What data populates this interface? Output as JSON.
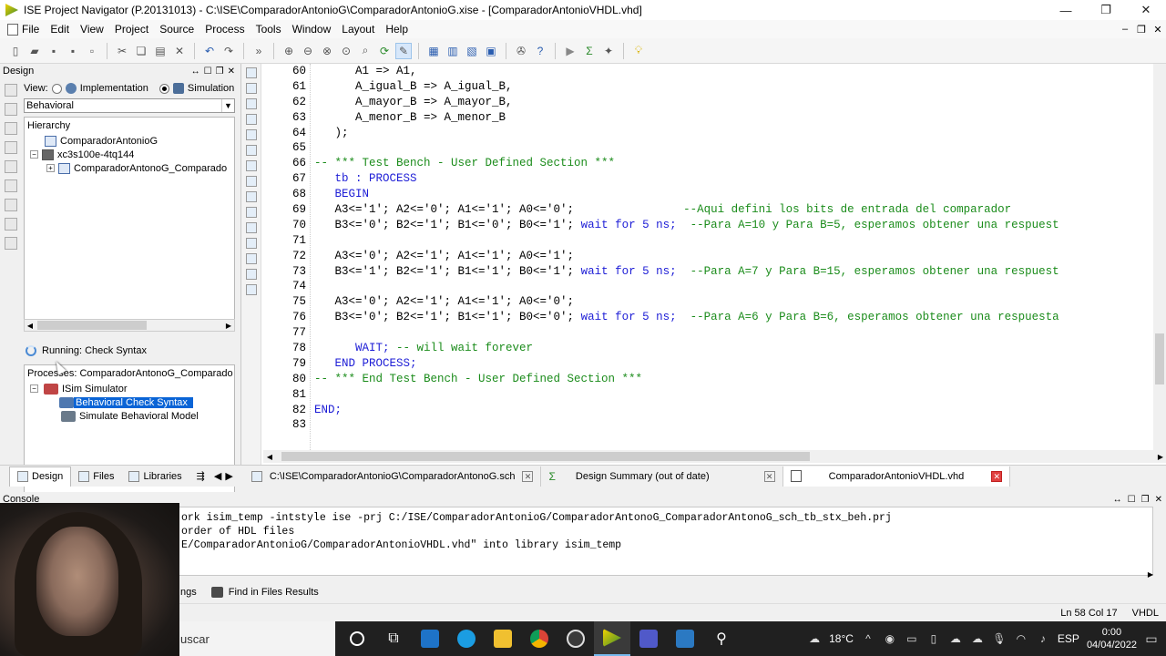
{
  "window": {
    "title": "ISE Project Navigator (P.20131013) - C:\\ISE\\ComparadorAntonioG\\ComparadorAntonioG.xise - [ComparadorAntonioVHDL.vhd]",
    "minimize": "—",
    "restore": "❐",
    "close": "✕"
  },
  "menu": {
    "items": [
      "File",
      "Edit",
      "View",
      "Project",
      "Source",
      "Process",
      "Tools",
      "Window",
      "Layout",
      "Help"
    ]
  },
  "design_panel": {
    "title": "Design",
    "view_label": "View:",
    "implementation_label": "Implementation",
    "simulation_label": "Simulation",
    "selected_view": "Behavioral",
    "hierarchy_title": "Hierarchy",
    "hierarchy_items": [
      "ComparadorAntonioG",
      "xc3s100e-4tq144",
      "ComparadorAntonoG_Comparado"
    ]
  },
  "process_panel": {
    "running": "Running: Check Syntax",
    "title": "Processes: ComparadorAntonoG_Comparado",
    "items": [
      "ISim Simulator",
      "Behavioral Check Syntax",
      "Simulate Behavioral Model"
    ]
  },
  "editor": {
    "lines": [
      {
        "n": "60",
        "t": "      A1 => A1,",
        "k": "pl"
      },
      {
        "n": "61",
        "t": "      A_igual_B => A_igual_B,",
        "k": "pl"
      },
      {
        "n": "62",
        "t": "      A_mayor_B => A_mayor_B,",
        "k": "pl"
      },
      {
        "n": "63",
        "t": "      A_menor_B => A_menor_B",
        "k": "pl"
      },
      {
        "n": "64",
        "t": "   );",
        "k": "pl"
      },
      {
        "n": "65",
        "t": "",
        "k": "pl"
      },
      {
        "n": "66",
        "t": "-- *** Test Bench - User Defined Section ***",
        "k": "cm"
      },
      {
        "n": "67",
        "t": "   tb : PROCESS",
        "k": "mix1"
      },
      {
        "n": "68",
        "t": "   BEGIN",
        "k": "kw"
      },
      {
        "n": "69",
        "t": "   A3<='1'; A2<='0'; A1<='1'; A0<='0';",
        "c": "                --Aqui defini los bits de entrada del comparador",
        "k": "pc"
      },
      {
        "n": "70",
        "t": "   B3<='0'; B2<='1'; B1<='0'; B0<='1'; ",
        "w": "wait for 5 ns;",
        "c": "  --Para A=10 y Para B=5, esperamos obtener una respuest",
        "k": "pwc"
      },
      {
        "n": "71",
        "t": "",
        "k": "pl"
      },
      {
        "n": "72",
        "t": "   A3<='0'; A2<='1'; A1<='1'; A0<='1';",
        "k": "pl"
      },
      {
        "n": "73",
        "t": "   B3<='1'; B2<='1'; B1<='1'; B0<='1'; ",
        "w": "wait for 5 ns;",
        "c": "  --Para A=7 y Para B=15, esperamos obtener una respuest",
        "k": "pwc"
      },
      {
        "n": "74",
        "t": "",
        "k": "pl"
      },
      {
        "n": "75",
        "t": "   A3<='0'; A2<='1'; A1<='1'; A0<='0';",
        "k": "pl"
      },
      {
        "n": "76",
        "t": "   B3<='0'; B2<='1'; B1<='1'; B0<='0'; ",
        "w": "wait for 5 ns;",
        "c": "  --Para A=6 y Para B=6, esperamos obtener una respuesta",
        "k": "pwc"
      },
      {
        "n": "77",
        "t": "",
        "k": "pl"
      },
      {
        "n": "78",
        "t": "      WAIT;",
        "c": " -- will wait forever",
        "k": "kc"
      },
      {
        "n": "79",
        "t": "   END PROCESS;",
        "k": "kw"
      },
      {
        "n": "80",
        "t": "-- *** End Test Bench - User Defined Section ***",
        "k": "cm"
      },
      {
        "n": "81",
        "t": "",
        "k": "pl"
      },
      {
        "n": "82",
        "t": "END;",
        "k": "kw"
      },
      {
        "n": "83",
        "t": "",
        "k": "pl"
      }
    ]
  },
  "panel_tabs": [
    "Design",
    "Files",
    "Libraries"
  ],
  "file_tabs": [
    {
      "label": "C:\\ISE\\ComparadorAntonioG\\ComparadorAntonoG.sch",
      "active": false
    },
    {
      "label": "Design Summary (out of date)",
      "active": false
    },
    {
      "label": "ComparadorAntonioVHDL.vhd",
      "active": true
    }
  ],
  "console": {
    "title": "Console",
    "lines": [
      "ork isim_temp -intstyle ise -prj C:/ISE/ComparadorAntonioG/ComparadorAntonoG_ComparadorAntonoG_sch_tb_stx_beh.prj",
      "order of HDL files",
      "E/ComparadorAntonioG/ComparadorAntonioVHDL.vhd\" into library isim_temp"
    ]
  },
  "bottom_tabs": [
    "ngs",
    "Find in Files Results"
  ],
  "status": {
    "position": "Ln 58 Col 17",
    "language": "VHDL"
  },
  "taskbar": {
    "search": "uscar",
    "temperature": "18°C",
    "language": "ESP",
    "time": "0:00",
    "date": "04/04/2022"
  },
  "colors": {
    "comment": "#1b8c1b",
    "keyword": "#1d1dd6",
    "selection": "#0a64d6"
  }
}
